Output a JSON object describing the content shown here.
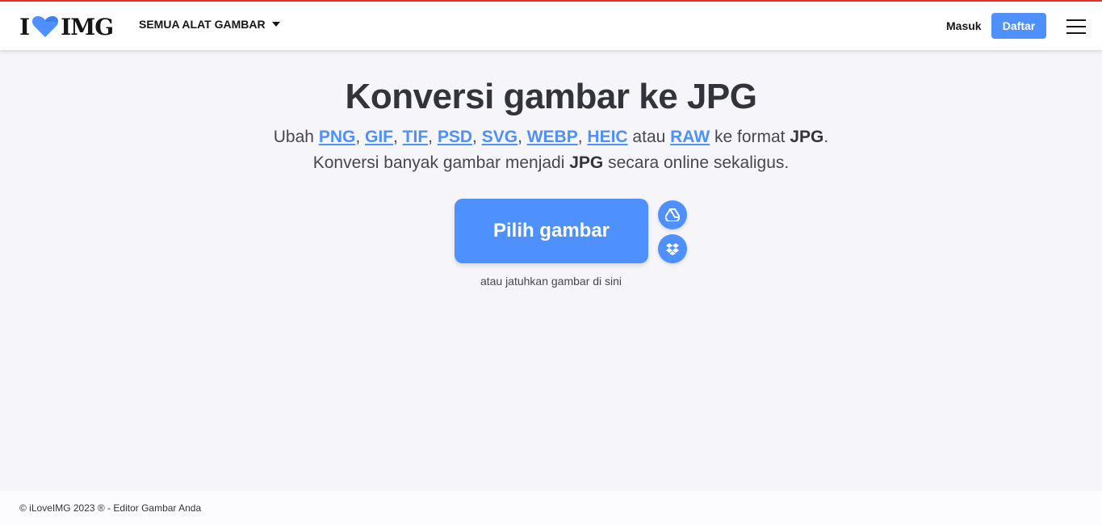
{
  "header": {
    "logo": {
      "left": "I",
      "right": "IMG"
    },
    "tools_menu_label": "SEMUA ALAT GAMBAR",
    "login_label": "Masuk",
    "signup_label": "Daftar"
  },
  "main": {
    "title": "Konversi gambar ke JPG",
    "line1": {
      "prefix": "Ubah ",
      "formats": [
        "PNG",
        "GIF",
        "TIF",
        "PSD",
        "SVG",
        "WEBP",
        "HEIC"
      ],
      "conj": " atau ",
      "last_format": "RAW",
      "suffix_pre": " ke format ",
      "target": "JPG",
      "suffix_post": "."
    },
    "line2": {
      "prefix": "Konversi banyak gambar menjadi ",
      "target": "JPG",
      "suffix": " secara online sekaligus."
    },
    "upload_button": "Pilih gambar",
    "cloud_buttons": [
      {
        "icon": "google-drive-icon"
      },
      {
        "icon": "dropbox-icon"
      }
    ],
    "drop_hint": "atau jatuhkan gambar di sini"
  },
  "footer": {
    "copyright": "© iLoveIMG 2023 ® - Editor Gambar Anda"
  },
  "colors": {
    "accent": "#4d90fe",
    "text": "#33333b",
    "background": "#f5f5fa"
  }
}
